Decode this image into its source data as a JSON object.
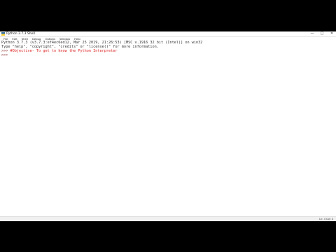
{
  "window": {
    "title": "Python 3.7.3 Shell",
    "controls": {
      "minimize": "—",
      "maximize": "□",
      "close": "✕"
    }
  },
  "menu": [
    "File",
    "Edit",
    "Shell",
    "Debug",
    "Options",
    "Window",
    "Help"
  ],
  "shell": {
    "banner_line1": "Python 3.7.3 (v3.7.3:ef4ec6ed12, Mar 25 2019, 21:26:53) [MSC v.1916 32 bit (Intel)] on win32",
    "banner_line2": "Type \"help\", \"copyright\", \"credits\" or \"license()\" for more information.",
    "prompt_line1": ">>> ",
    "input_line1": "#Objective- To get to know the Python Interpreter",
    "prompt_line2": ">>> "
  },
  "status": {
    "position": "Ln: 4  Col: 4"
  },
  "colors": {
    "comment": "#dd2222",
    "prompt": "#8a2a2a",
    "background": "#000000"
  }
}
